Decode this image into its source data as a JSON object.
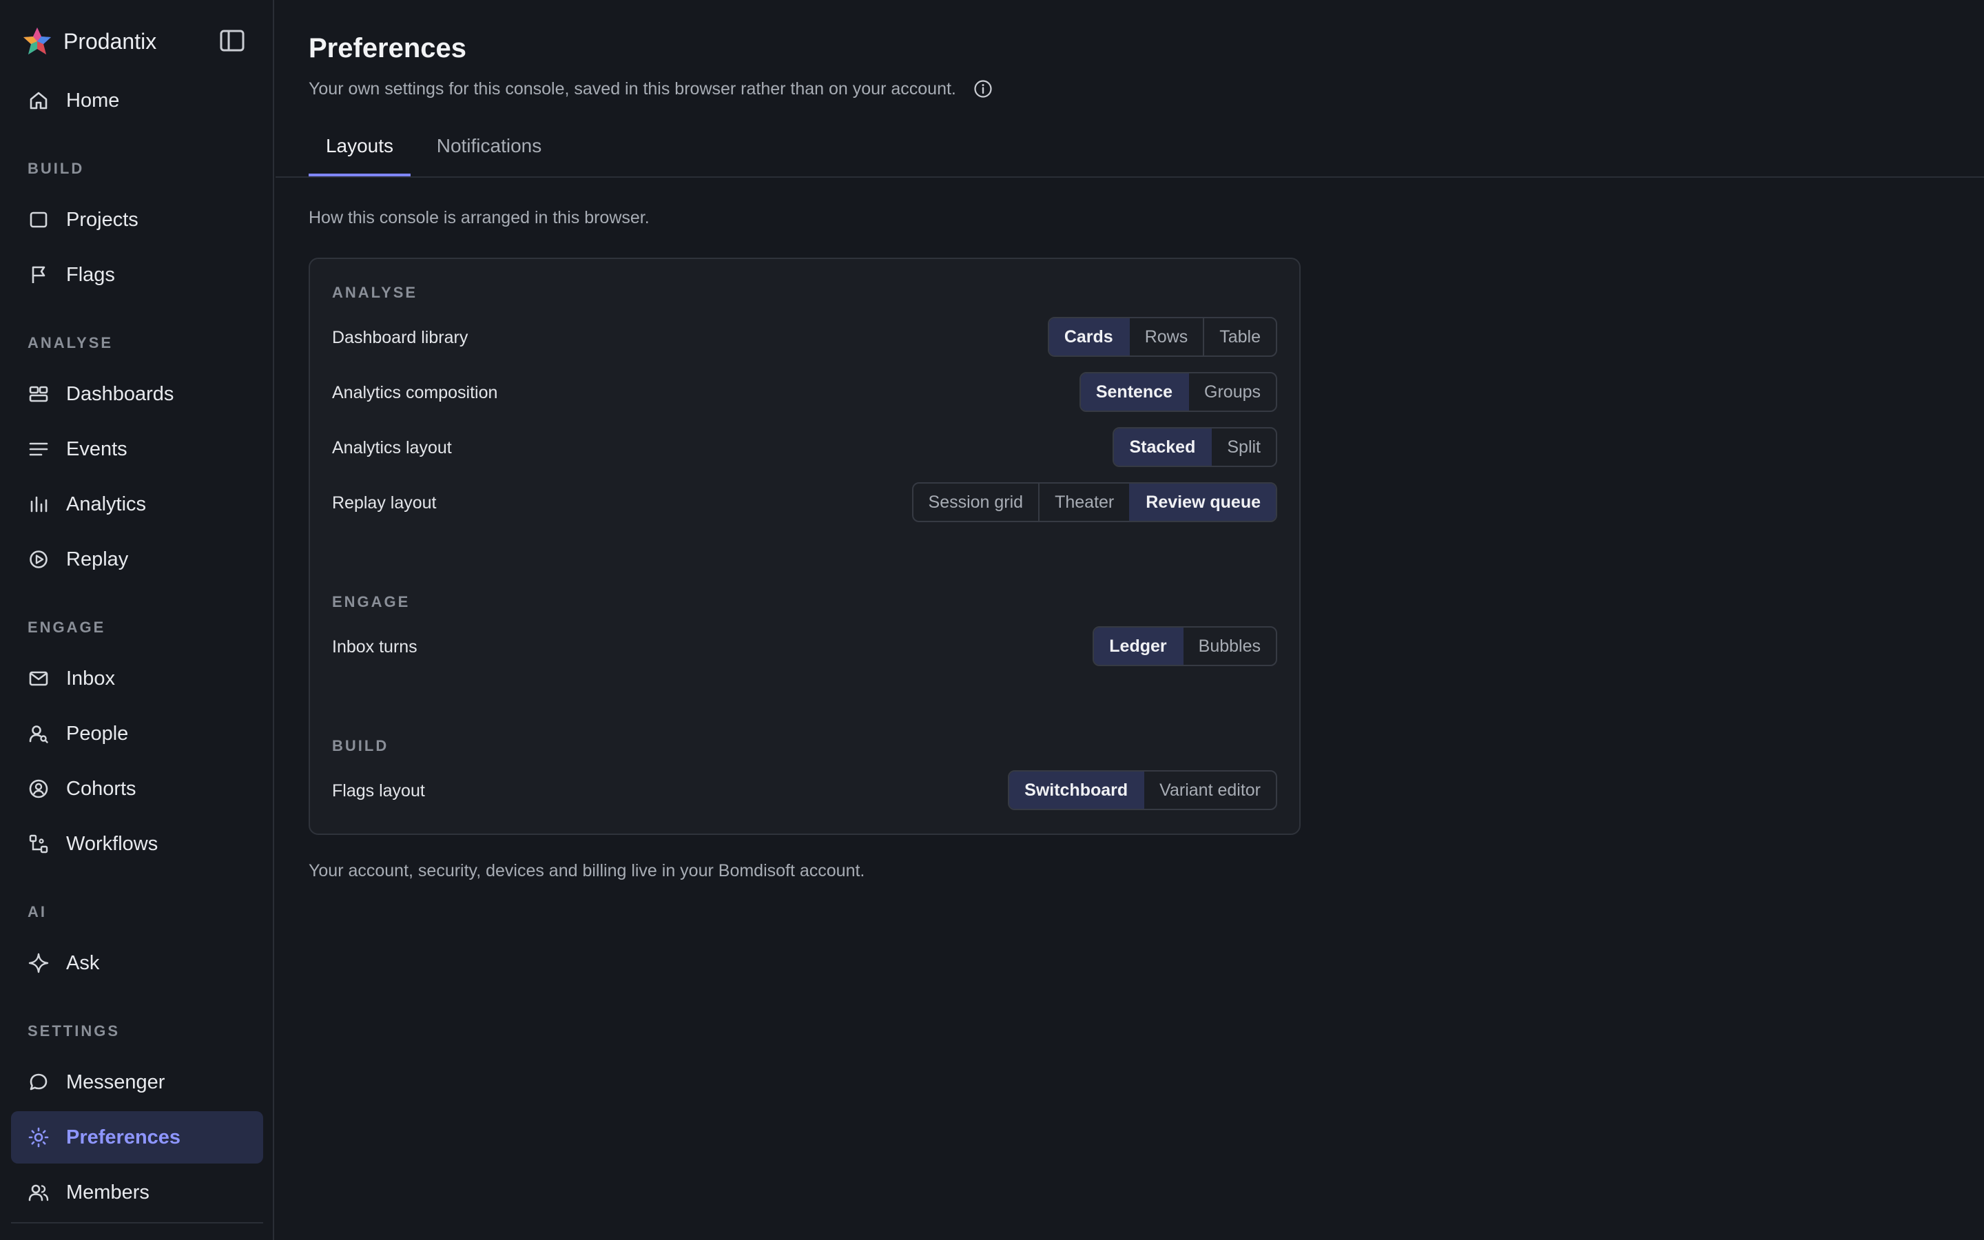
{
  "brand": {
    "name": "Prodantix"
  },
  "sidebar": {
    "home": "Home",
    "sections": {
      "build": "BUILD",
      "analyse": "ANALYSE",
      "engage": "ENGAGE",
      "ai": "AI",
      "settings": "SETTINGS"
    },
    "items": {
      "projects": "Projects",
      "flags": "Flags",
      "dashboards": "Dashboards",
      "events": "Events",
      "analytics": "Analytics",
      "replay": "Replay",
      "inbox": "Inbox",
      "people": "People",
      "cohorts": "Cohorts",
      "workflows": "Workflows",
      "ask": "Ask",
      "messenger": "Messenger",
      "preferences": "Preferences",
      "members": "Members"
    },
    "active_item": "Preferences"
  },
  "page": {
    "title": "Preferences",
    "subtitle": "Your own settings for this console, saved in this browser rather than on your account."
  },
  "tabs": {
    "layouts": "Layouts",
    "notifications": "Notifications",
    "active": "Layouts"
  },
  "layouts": {
    "description": "How this console is arranged in this browser.",
    "groups": {
      "analyse": {
        "heading": "ANALYSE",
        "dashboard_library": {
          "label": "Dashboard library",
          "options": [
            "Cards",
            "Rows",
            "Table"
          ],
          "selected": "Cards"
        },
        "analytics_composition": {
          "label": "Analytics composition",
          "options": [
            "Sentence",
            "Groups"
          ],
          "selected": "Sentence"
        },
        "analytics_layout": {
          "label": "Analytics layout",
          "options": [
            "Stacked",
            "Split"
          ],
          "selected": "Stacked"
        },
        "replay_layout": {
          "label": "Replay layout",
          "options": [
            "Session grid",
            "Theater",
            "Review queue"
          ],
          "selected": "Review queue"
        }
      },
      "engage": {
        "heading": "ENGAGE",
        "inbox_turns": {
          "label": "Inbox turns",
          "options": [
            "Ledger",
            "Bubbles"
          ],
          "selected": "Ledger"
        }
      },
      "build": {
        "heading": "BUILD",
        "flags_layout": {
          "label": "Flags layout",
          "options": [
            "Switchboard",
            "Variant editor"
          ],
          "selected": "Switchboard"
        }
      }
    },
    "footer": "Your account, security, devices and billing live in your Bomdisoft account."
  },
  "colors": {
    "background": "#15181e",
    "card": "#1b1e24",
    "accent": "#7f86ff",
    "active_nav_bg": "#262c46",
    "selected_segment_bg": "#2b3150"
  }
}
